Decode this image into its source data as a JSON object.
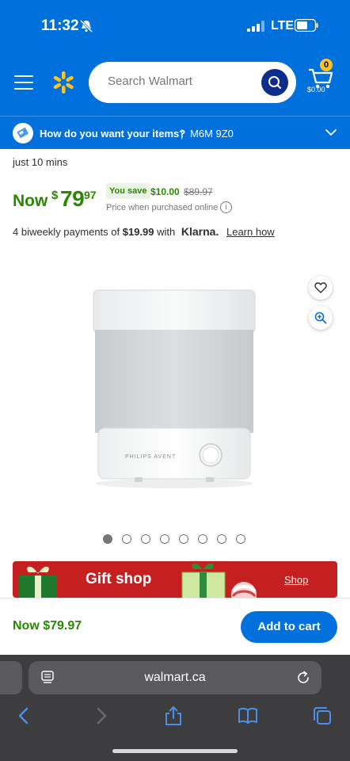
{
  "status_bar": {
    "time": "11:32",
    "network": "LTE"
  },
  "header": {
    "search_placeholder": "Search Walmart",
    "cart_count": "0",
    "cart_total": "$0.00"
  },
  "delivery": {
    "question": "How do you want your items?",
    "separator": "|",
    "postal_code": "M6M 9Z0"
  },
  "product": {
    "delivery_text": "just 10 mins",
    "now_label": "Now",
    "currency": "$",
    "price_whole": "79",
    "price_cents": "97",
    "you_save_label": "You save",
    "save_amount": "$10.00",
    "was_price": "$89.97",
    "price_note": "Price when purchased online",
    "klarna": {
      "prefix": "4 biweekly payments of",
      "amount": "$19.99",
      "with": "with",
      "brand": "Klarna.",
      "link": "Learn how"
    },
    "brand_print": "PHILIPS AVENT",
    "image_count": 8,
    "active_image_index": 0
  },
  "banner": {
    "title": "Gift shop",
    "link": "Shop"
  },
  "cart_bar": {
    "price": "Now $79.97",
    "add_label": "Add to cart"
  },
  "browser": {
    "url": "walmart.ca"
  },
  "colors": {
    "walmart_blue": "#0071dc",
    "price_green": "#2a8703",
    "spark_yellow": "#ffc220",
    "banner_red": "#c4201f"
  },
  "icons": [
    "bell-slash-icon",
    "signal-icon",
    "battery-icon",
    "menu-icon",
    "walmart-spark-icon",
    "search-icon",
    "cart-icon",
    "chevron-down-icon",
    "info-icon",
    "heart-icon",
    "zoom-icon",
    "reader-icon",
    "reload-icon",
    "back-icon",
    "forward-icon",
    "share-icon",
    "bookmarks-icon",
    "tabs-icon"
  ]
}
